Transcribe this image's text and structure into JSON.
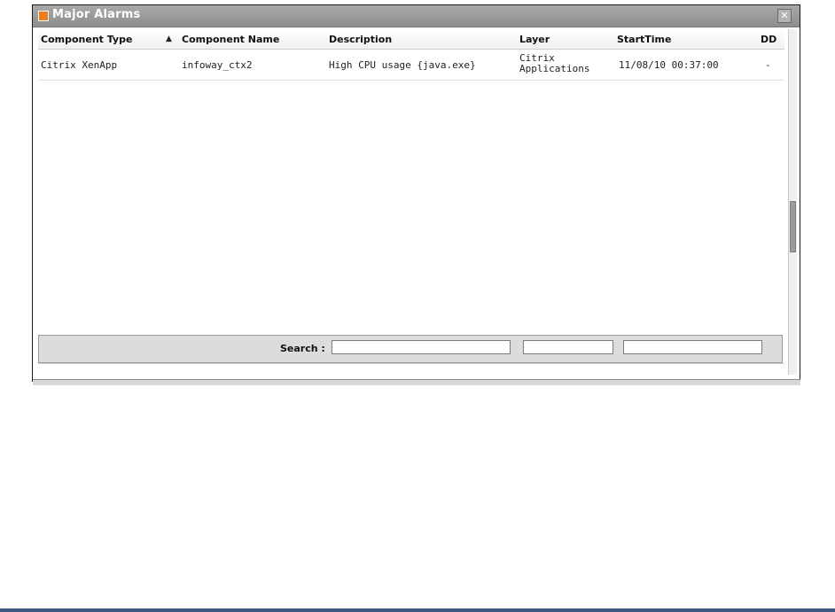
{
  "window": {
    "title": "Major Alarms",
    "close_glyph": "✕"
  },
  "table": {
    "columns": [
      {
        "label": "Component Type"
      },
      {
        "label": "Component Name"
      },
      {
        "label": "Description"
      },
      {
        "label": "Layer"
      },
      {
        "label": "StartTime"
      },
      {
        "label": "DD"
      }
    ],
    "sort_indicator": "▲",
    "rows": [
      {
        "component_type": "Citrix XenApp",
        "component_name": "infoway_ctx2",
        "description": "High CPU usage {java.exe}",
        "layer": "Citrix Applications",
        "start_time": "11/08/10 00:37:00",
        "dd": "-"
      }
    ]
  },
  "search": {
    "label": "Search :",
    "fields": [
      {
        "value": ""
      },
      {
        "value": ""
      },
      {
        "value": ""
      }
    ]
  },
  "colors": {
    "title_accent": "#f07c1c",
    "titlebar": "#9a9a9a",
    "bottom_rule": "#3c5a80"
  },
  "icons": {
    "title": "orange-square-icon",
    "close": "close-icon",
    "sort": "sort-ascending-icon"
  }
}
